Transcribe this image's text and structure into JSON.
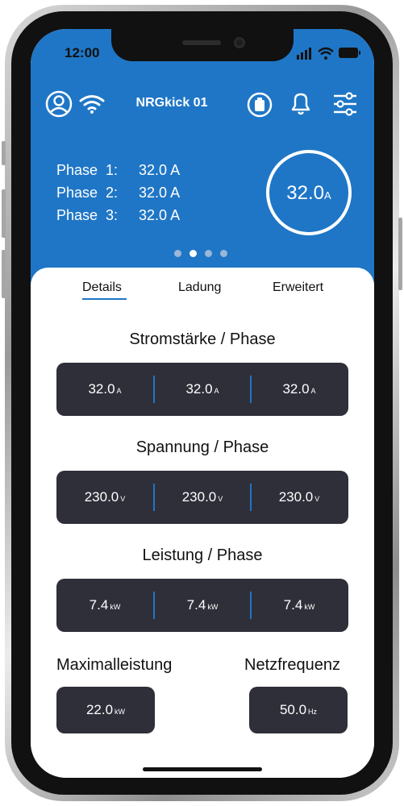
{
  "status_bar": {
    "time": "12:00"
  },
  "header": {
    "title": "NRGkick 01",
    "icons": [
      "user-icon",
      "wifi-icon",
      "charger-icon",
      "bell-icon",
      "settings-sliders-icon"
    ]
  },
  "phases": [
    {
      "label": "Phase",
      "num": "1:",
      "value": "32.0 A"
    },
    {
      "label": "Phase",
      "num": "2:",
      "value": "32.0 A"
    },
    {
      "label": "Phase",
      "num": "3:",
      "value": "32.0 A"
    }
  ],
  "total_current": {
    "value": "32.0",
    "unit": "A"
  },
  "pager": {
    "count": 4,
    "active_index": 1
  },
  "tabs": [
    {
      "label": "Details",
      "active": true
    },
    {
      "label": "Ladung",
      "active": false
    },
    {
      "label": "Erweitert",
      "active": false
    }
  ],
  "sections": {
    "current": {
      "title": "Stromstärke / Phase",
      "values": [
        {
          "v": "32.0",
          "u": "A"
        },
        {
          "v": "32.0",
          "u": "A"
        },
        {
          "v": "32.0",
          "u": "A"
        }
      ]
    },
    "voltage": {
      "title": "Spannung / Phase",
      "values": [
        {
          "v": "230.0",
          "u": "V"
        },
        {
          "v": "230.0",
          "u": "V"
        },
        {
          "v": "230.0",
          "u": "V"
        }
      ]
    },
    "power": {
      "title": "Leistung / Phase",
      "values": [
        {
          "v": "7.4",
          "u": "kW"
        },
        {
          "v": "7.4",
          "u": "kW"
        },
        {
          "v": "7.4",
          "u": "kW"
        }
      ]
    }
  },
  "max_power": {
    "title": "Maximalleistung",
    "value": "22.0",
    "unit": "kW"
  },
  "frequency": {
    "title": "Netzfrequenz",
    "value": "50.0",
    "unit": "Hz"
  },
  "colors": {
    "accent": "#1f76c6",
    "panel": "#2f2f3a",
    "text": "#111111"
  }
}
